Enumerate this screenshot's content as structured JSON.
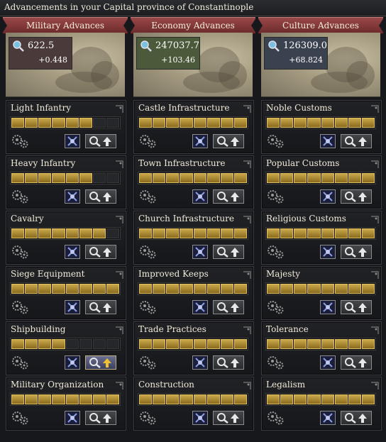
{
  "title": "Advancements in your Capital province of Constantinople",
  "colors": {
    "ribbon": "#8a3a3a",
    "bar_filled": "#c9a84a",
    "bar_empty": "#25272b"
  },
  "categories": [
    {
      "header": "Military Advances",
      "points": "622.5",
      "rate": "+0.448",
      "art_icon": "knight-helmet-icon",
      "techs": [
        {
          "name": "Light Infantry",
          "level": 6
        },
        {
          "name": "Heavy Infantry",
          "level": 6
        },
        {
          "name": "Cavalry",
          "level": 7
        },
        {
          "name": "Siege Equipment",
          "level": 8
        },
        {
          "name": "Shipbuilding",
          "level": 4
        },
        {
          "name": "Military Organization",
          "level": 8
        }
      ]
    },
    {
      "header": "Economy Advances",
      "points": "247037.7",
      "rate": "+103.46",
      "art_icon": "treasure-chest-icon",
      "techs": [
        {
          "name": "Castle Infrastructure",
          "level": 8
        },
        {
          "name": "Town Infrastructure",
          "level": 8
        },
        {
          "name": "Church Infrastructure",
          "level": 8
        },
        {
          "name": "Improved Keeps",
          "level": 8
        },
        {
          "name": "Trade Practices",
          "level": 8
        },
        {
          "name": "Construction",
          "level": 8
        }
      ]
    },
    {
      "header": "Culture Advances",
      "points": "126309.0",
      "rate": "+68.824",
      "art_icon": "books-icon",
      "techs": [
        {
          "name": "Noble Customs",
          "level": 8
        },
        {
          "name": "Popular Customs",
          "level": 8
        },
        {
          "name": "Religious Customs",
          "level": 8
        },
        {
          "name": "Majesty",
          "level": 8
        },
        {
          "name": "Tolerance",
          "level": 8
        },
        {
          "name": "Legalism",
          "level": 8
        }
      ]
    }
  ],
  "max_level": 8
}
